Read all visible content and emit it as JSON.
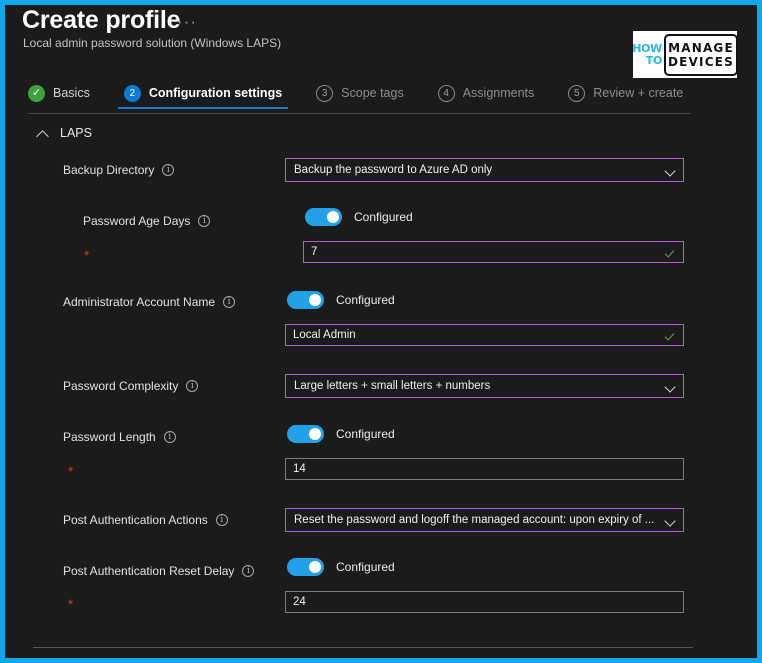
{
  "header": {
    "title": "Create profile",
    "more_label": "···",
    "subtitle": "Local admin password solution (Windows LAPS)"
  },
  "logo": {
    "how": "HOW",
    "to": "TO",
    "manage": "MANAGE",
    "devices": "DEVICES"
  },
  "tabs": [
    {
      "badge": "✓",
      "label": "Basics",
      "state": "done"
    },
    {
      "badge": "2",
      "label": "Configuration settings",
      "state": "active"
    },
    {
      "badge": "3",
      "label": "Scope tags",
      "state": "idle"
    },
    {
      "badge": "4",
      "label": "Assignments",
      "state": "idle"
    },
    {
      "badge": "5",
      "label": "Review + create",
      "state": "idle"
    }
  ],
  "section": {
    "title": "LAPS",
    "collapse_icon": "chevron-up-icon"
  },
  "fields": {
    "backup_directory": {
      "label": "Backup Directory",
      "value": "Backup the password to Azure AD only"
    },
    "password_age_days": {
      "label": "Password Age Days",
      "toggle_label": "Configured",
      "value": "7",
      "required_mark": "*"
    },
    "administrator_account_name": {
      "label": "Administrator Account Name",
      "toggle_label": "Configured",
      "value": "Local Admin"
    },
    "password_complexity": {
      "label": "Password Complexity",
      "value": "Large letters + small letters + numbers"
    },
    "password_length": {
      "label": "Password Length",
      "toggle_label": "Configured",
      "value": "14",
      "required_mark": "*"
    },
    "post_authentication_actions": {
      "label": "Post Authentication Actions",
      "value": "Reset the password and logoff the managed account: upon expiry of ..."
    },
    "post_authentication_reset_delay": {
      "label": "Post Authentication Reset Delay",
      "toggle_label": "Configured",
      "value": "24",
      "required_mark": "*"
    }
  },
  "colors": {
    "frame_border": "#12a7e8",
    "accent_border": "#b55cd6",
    "toggle_on": "#22a0e8",
    "tab_active": "#0f7ad1",
    "tab_done": "#3fa23f",
    "required": "#d13438"
  }
}
